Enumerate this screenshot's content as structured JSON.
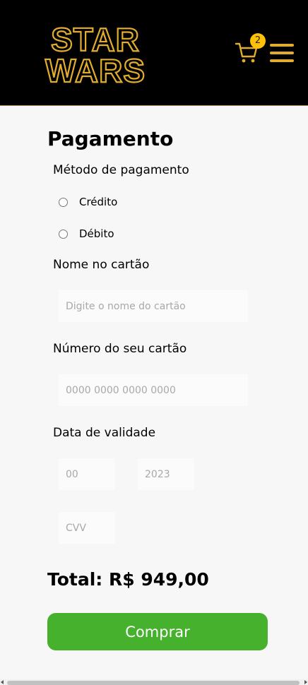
{
  "header": {
    "logo_line1": "STAR",
    "logo_line2": "WARS",
    "cart_count": "2",
    "cart_icon": "cart-icon",
    "menu_icon": "hamburger-menu-icon"
  },
  "payment": {
    "title": "Pagamento",
    "method_label": "Método de pagamento",
    "options": [
      "Crédito",
      "Débito"
    ],
    "card_name_label": "Nome no cartão",
    "card_name_placeholder": "Digite o nome do cartão",
    "card_number_label": "Número do seu cartão",
    "card_number_placeholder": "0000 0000 0000 0000",
    "expiry_label": "Data de validade",
    "expiry_month_placeholder": "00",
    "expiry_year_placeholder": "2023",
    "cvv_placeholder": "CVV",
    "total": "Total: R$ 949,00",
    "buy_label": "Comprar"
  },
  "colors": {
    "header_bg": "#000000",
    "brand_gold": "#e2ad2f",
    "badge": "#ffc107",
    "buy_button": "#46b12d"
  }
}
